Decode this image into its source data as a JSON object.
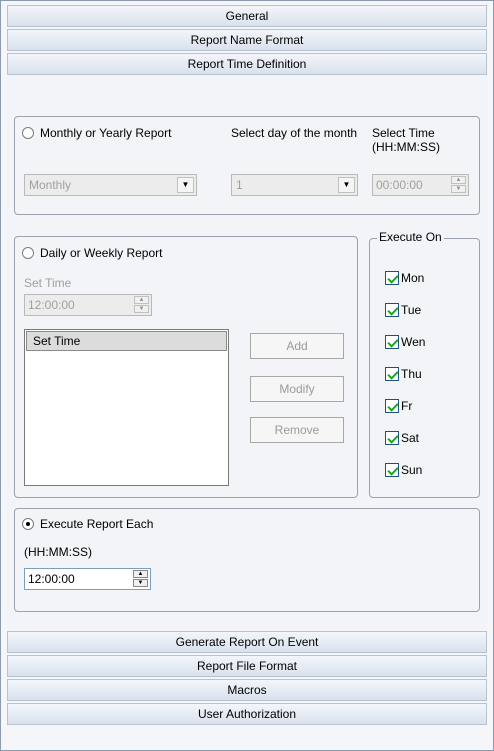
{
  "sections_top": [
    "General",
    "Report Name Format",
    "Report Time Definition"
  ],
  "sections_bottom": [
    "Generate Report On Event",
    "Report File Format",
    "Macros",
    "User Authorization"
  ],
  "monthly": {
    "radio_label": "Monthly or Yearly Report",
    "day_label": "Select day of the month",
    "time_label": "Select Time (HH:MM:SS)",
    "period_value": "Monthly",
    "day_value": "1",
    "time_value": "00:00:00"
  },
  "daily": {
    "radio_label": "Daily or Weekly Report",
    "set_time_label": "Set Time",
    "time_value": "12:00:00",
    "list_header": "Set Time",
    "add_label": "Add",
    "modify_label": "Modify",
    "remove_label": "Remove"
  },
  "execute_on": {
    "title": "Execute On",
    "days": [
      "Mon",
      "Tue",
      "Wen",
      "Thu",
      "Fr",
      "Sat",
      "Sun"
    ]
  },
  "each": {
    "radio_label": "Execute Report Each",
    "format_label": "(HH:MM:SS)",
    "time_value": "12:00:00"
  }
}
